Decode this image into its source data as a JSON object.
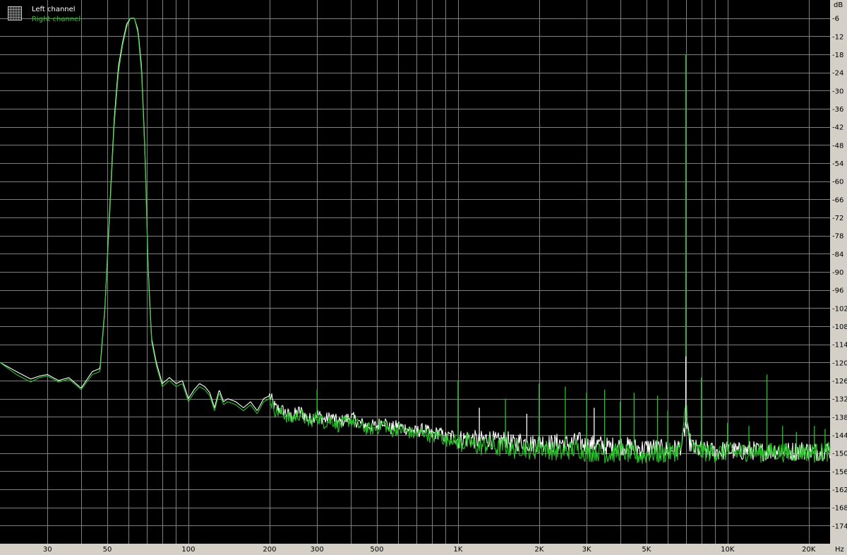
{
  "colors": {
    "background": "#000000",
    "frame": "#d4d0c8",
    "grid": "#7f7f7f",
    "left_channel": "#ffffff",
    "right_channel": "#22c522"
  },
  "icons": {
    "legend": "grid-icon"
  },
  "chart_data": {
    "type": "line",
    "x_scale": "log",
    "xlim": [
      20,
      24000
    ],
    "ylim": [
      -180,
      0
    ],
    "grid": true,
    "legend_position": "top-left",
    "xunit": "Hz",
    "yunit": "dB",
    "xticks": [
      {
        "v": 30,
        "label": "30"
      },
      {
        "v": 50,
        "label": "50"
      },
      {
        "v": 100,
        "label": "100"
      },
      {
        "v": 200,
        "label": "200"
      },
      {
        "v": 300,
        "label": "300"
      },
      {
        "v": 500,
        "label": "500"
      },
      {
        "v": 1000,
        "label": "1K"
      },
      {
        "v": 2000,
        "label": "2K"
      },
      {
        "v": 3000,
        "label": "3K"
      },
      {
        "v": 5000,
        "label": "5K"
      },
      {
        "v": 10000,
        "label": "10K"
      },
      {
        "v": 20000,
        "label": "20K"
      }
    ],
    "yticks": [
      {
        "v": -6,
        "label": "-6"
      },
      {
        "v": -12,
        "label": "-12"
      },
      {
        "v": -18,
        "label": "-18"
      },
      {
        "v": -24,
        "label": "-24"
      },
      {
        "v": -30,
        "label": "-30"
      },
      {
        "v": -36,
        "label": "-36"
      },
      {
        "v": -42,
        "label": "-42"
      },
      {
        "v": -48,
        "label": "-48"
      },
      {
        "v": -54,
        "label": "-54"
      },
      {
        "v": -60,
        "label": "-60"
      },
      {
        "v": -66,
        "label": "-66"
      },
      {
        "v": -72,
        "label": "-72"
      },
      {
        "v": -78,
        "label": "-78"
      },
      {
        "v": -84,
        "label": "-84"
      },
      {
        "v": -90,
        "label": "-90"
      },
      {
        "v": -96,
        "label": "-96"
      },
      {
        "v": -102,
        "label": "-102"
      },
      {
        "v": -108,
        "label": "-108"
      },
      {
        "v": -114,
        "label": "-114"
      },
      {
        "v": -120,
        "label": "-120"
      },
      {
        "v": -126,
        "label": "-126"
      },
      {
        "v": -132,
        "label": "-132"
      },
      {
        "v": -138,
        "label": "-138"
      },
      {
        "v": -144,
        "label": "-144"
      },
      {
        "v": -150,
        "label": "-150"
      },
      {
        "v": -156,
        "label": "-156"
      },
      {
        "v": -162,
        "label": "-162"
      },
      {
        "v": -168,
        "label": "-168"
      },
      {
        "v": -174,
        "label": "-174"
      }
    ],
    "series": [
      {
        "name": "Left channel",
        "color": "#ffffff",
        "points": [
          [
            20,
            -120
          ],
          [
            23,
            -123
          ],
          [
            26,
            -125.5
          ],
          [
            28,
            -124.5
          ],
          [
            30,
            -124
          ],
          [
            33,
            -126
          ],
          [
            36,
            -125
          ],
          [
            40,
            -128.5
          ],
          [
            44,
            -123
          ],
          [
            47,
            -122
          ],
          [
            49,
            -102
          ],
          [
            51,
            -70
          ],
          [
            53,
            -40
          ],
          [
            55,
            -22
          ],
          [
            57,
            -14
          ],
          [
            59,
            -8
          ],
          [
            61,
            -6
          ],
          [
            63,
            -6
          ],
          [
            65,
            -10
          ],
          [
            67,
            -22
          ],
          [
            69,
            -50
          ],
          [
            71,
            -90
          ],
          [
            73,
            -112
          ],
          [
            76,
            -120
          ],
          [
            80,
            -127
          ],
          [
            85,
            -125
          ],
          [
            90,
            -127
          ],
          [
            95,
            -126
          ],
          [
            100,
            -132
          ],
          [
            105,
            -129
          ],
          [
            110,
            -127
          ],
          [
            115,
            -128
          ],
          [
            120,
            -130
          ],
          [
            125,
            -135
          ],
          [
            130,
            -129
          ],
          [
            135,
            -133
          ],
          [
            140,
            -132
          ],
          [
            150,
            -133
          ],
          [
            160,
            -135
          ],
          [
            170,
            -133
          ],
          [
            180,
            -136
          ],
          [
            190,
            -132
          ],
          [
            200,
            -131
          ],
          [
            210,
            -135
          ],
          [
            225,
            -136
          ],
          [
            240,
            -138
          ],
          [
            260,
            -136
          ],
          [
            280,
            -139
          ],
          [
            300,
            -137
          ],
          [
            320,
            -139
          ],
          [
            340,
            -138
          ],
          [
            360,
            -140
          ],
          [
            380,
            -139
          ],
          [
            400,
            -138
          ],
          [
            430,
            -140
          ],
          [
            460,
            -141
          ],
          [
            500,
            -141
          ],
          [
            530,
            -139
          ],
          [
            560,
            -142
          ],
          [
            600,
            -141
          ],
          [
            650,
            -142
          ],
          [
            700,
            -143
          ],
          [
            750,
            -142
          ],
          [
            800,
            -144
          ],
          [
            850,
            -143
          ],
          [
            900,
            -145
          ],
          [
            950,
            -144
          ],
          [
            1000,
            -145.5
          ],
          [
            1100,
            -145
          ],
          [
            1200,
            -146
          ],
          [
            1300,
            -145
          ],
          [
            1400,
            -146.5
          ],
          [
            1500,
            -145.5
          ],
          [
            1600,
            -147
          ],
          [
            1700,
            -146
          ],
          [
            1800,
            -146.5
          ],
          [
            1900,
            -147
          ],
          [
            2000,
            -146
          ],
          [
            2200,
            -147
          ],
          [
            2400,
            -146.5
          ],
          [
            2600,
            -147
          ],
          [
            2800,
            -146
          ],
          [
            3000,
            -147.5
          ],
          [
            3300,
            -147
          ],
          [
            3600,
            -148
          ],
          [
            4000,
            -147.5
          ],
          [
            4400,
            -148
          ],
          [
            4800,
            -148.5
          ],
          [
            5200,
            -148
          ],
          [
            5600,
            -148.5
          ],
          [
            6000,
            -149
          ],
          [
            6500,
            -148.5
          ],
          [
            6800,
            -147
          ],
          [
            7000,
            -140
          ],
          [
            7200,
            -146
          ],
          [
            7500,
            -148.5
          ],
          [
            8000,
            -149
          ],
          [
            9000,
            -149.5
          ],
          [
            10000,
            -149
          ],
          [
            11000,
            -149.5
          ],
          [
            12000,
            -149
          ],
          [
            13500,
            -149.5
          ],
          [
            15000,
            -149
          ],
          [
            17000,
            -149.5
          ],
          [
            19000,
            -149
          ],
          [
            21000,
            -149.5
          ],
          [
            24000,
            -149
          ]
        ]
      },
      {
        "name": "Right channel",
        "color": "#22c522",
        "points": [
          [
            20,
            -120
          ],
          [
            23,
            -124
          ],
          [
            26,
            -126.5
          ],
          [
            28,
            -125
          ],
          [
            30,
            -124.5
          ],
          [
            33,
            -126.5
          ],
          [
            36,
            -125.5
          ],
          [
            40,
            -129
          ],
          [
            44,
            -124
          ],
          [
            47,
            -123
          ],
          [
            49,
            -103
          ],
          [
            51,
            -72
          ],
          [
            53,
            -42
          ],
          [
            55,
            -24
          ],
          [
            57,
            -15
          ],
          [
            59,
            -9
          ],
          [
            61,
            -6
          ],
          [
            63,
            -6
          ],
          [
            65,
            -11
          ],
          [
            67,
            -24
          ],
          [
            69,
            -52
          ],
          [
            71,
            -92
          ],
          [
            73,
            -113
          ],
          [
            76,
            -121
          ],
          [
            80,
            -128
          ],
          [
            85,
            -126
          ],
          [
            90,
            -128
          ],
          [
            95,
            -127
          ],
          [
            100,
            -133
          ],
          [
            105,
            -130
          ],
          [
            110,
            -128
          ],
          [
            115,
            -129
          ],
          [
            120,
            -131
          ],
          [
            125,
            -136
          ],
          [
            130,
            -130
          ],
          [
            135,
            -134
          ],
          [
            140,
            -133
          ],
          [
            150,
            -134
          ],
          [
            160,
            -136
          ],
          [
            170,
            -134
          ],
          [
            180,
            -137
          ],
          [
            190,
            -133
          ],
          [
            200,
            -132
          ],
          [
            210,
            -136
          ],
          [
            225,
            -137
          ],
          [
            240,
            -139
          ],
          [
            260,
            -137
          ],
          [
            280,
            -140
          ],
          [
            300,
            -138
          ],
          [
            320,
            -140
          ],
          [
            340,
            -139
          ],
          [
            360,
            -141
          ],
          [
            380,
            -140
          ],
          [
            400,
            -139
          ],
          [
            430,
            -141
          ],
          [
            460,
            -142
          ],
          [
            500,
            -142
          ],
          [
            530,
            -140
          ],
          [
            560,
            -143
          ],
          [
            600,
            -142
          ],
          [
            650,
            -143
          ],
          [
            700,
            -144
          ],
          [
            750,
            -143
          ],
          [
            800,
            -145
          ],
          [
            850,
            -144
          ],
          [
            900,
            -146
          ],
          [
            950,
            -145
          ],
          [
            1000,
            -147
          ],
          [
            1100,
            -146.5
          ],
          [
            1200,
            -148
          ],
          [
            1300,
            -147
          ],
          [
            1400,
            -148.5
          ],
          [
            1500,
            -147.5
          ],
          [
            1600,
            -149
          ],
          [
            1700,
            -148
          ],
          [
            1800,
            -148.5
          ],
          [
            1900,
            -149.5
          ],
          [
            2000,
            -148
          ],
          [
            2200,
            -149
          ],
          [
            2400,
            -150
          ],
          [
            2600,
            -149
          ],
          [
            2800,
            -148.5
          ],
          [
            3000,
            -150
          ],
          [
            3300,
            -149.5
          ],
          [
            3600,
            -150.5
          ],
          [
            4000,
            -149.5
          ],
          [
            4400,
            -150.5
          ],
          [
            4800,
            -151
          ],
          [
            5200,
            -150
          ],
          [
            5600,
            -150.5
          ],
          [
            6000,
            -150
          ],
          [
            6500,
            -149.5
          ],
          [
            6800,
            -148
          ],
          [
            7000,
            -132
          ],
          [
            7200,
            -145
          ],
          [
            7500,
            -149
          ],
          [
            8000,
            -149.5
          ],
          [
            9000,
            -150
          ],
          [
            10000,
            -149.5
          ],
          [
            11000,
            -150
          ],
          [
            12000,
            -149.5
          ],
          [
            13500,
            -150
          ],
          [
            15000,
            -149.5
          ],
          [
            17000,
            -150
          ],
          [
            19000,
            -149.5
          ],
          [
            21000,
            -150
          ],
          [
            24000,
            -149.5
          ]
        ]
      }
    ],
    "spikes": [
      {
        "series": "Right channel",
        "f": 300,
        "db": -129
      },
      {
        "series": "Right channel",
        "f": 1000,
        "db": -126
      },
      {
        "series": "Left channel",
        "f": 1200,
        "db": -135
      },
      {
        "series": "Right channel",
        "f": 1500,
        "db": -132
      },
      {
        "series": "Left channel",
        "f": 1800,
        "db": -137
      },
      {
        "series": "Right channel",
        "f": 2000,
        "db": -127
      },
      {
        "series": "Right channel",
        "f": 2500,
        "db": -128
      },
      {
        "series": "Right channel",
        "f": 3000,
        "db": -130
      },
      {
        "series": "Left channel",
        "f": 3200,
        "db": -135
      },
      {
        "series": "Right channel",
        "f": 3500,
        "db": -129
      },
      {
        "series": "Right channel",
        "f": 4000,
        "db": -133
      },
      {
        "series": "Right channel",
        "f": 4500,
        "db": -130
      },
      {
        "series": "Right channel",
        "f": 5500,
        "db": -131
      },
      {
        "series": "Right channel",
        "f": 6000,
        "db": -136
      },
      {
        "series": "Right channel",
        "f": 7000,
        "db": -18
      },
      {
        "series": "Left channel",
        "f": 7000,
        "db": -118
      },
      {
        "series": "Right channel",
        "f": 8000,
        "db": -125
      },
      {
        "series": "Right channel",
        "f": 10000,
        "db": -140
      },
      {
        "series": "Right channel",
        "f": 12000,
        "db": -141
      },
      {
        "series": "Right channel",
        "f": 14000,
        "db": -124
      },
      {
        "series": "Right channel",
        "f": 16000,
        "db": -141
      },
      {
        "series": "Right channel",
        "f": 18000,
        "db": -143
      },
      {
        "series": "Right channel",
        "f": 21000,
        "db": -141
      },
      {
        "series": "Right channel",
        "f": 23000,
        "db": -142
      }
    ]
  }
}
